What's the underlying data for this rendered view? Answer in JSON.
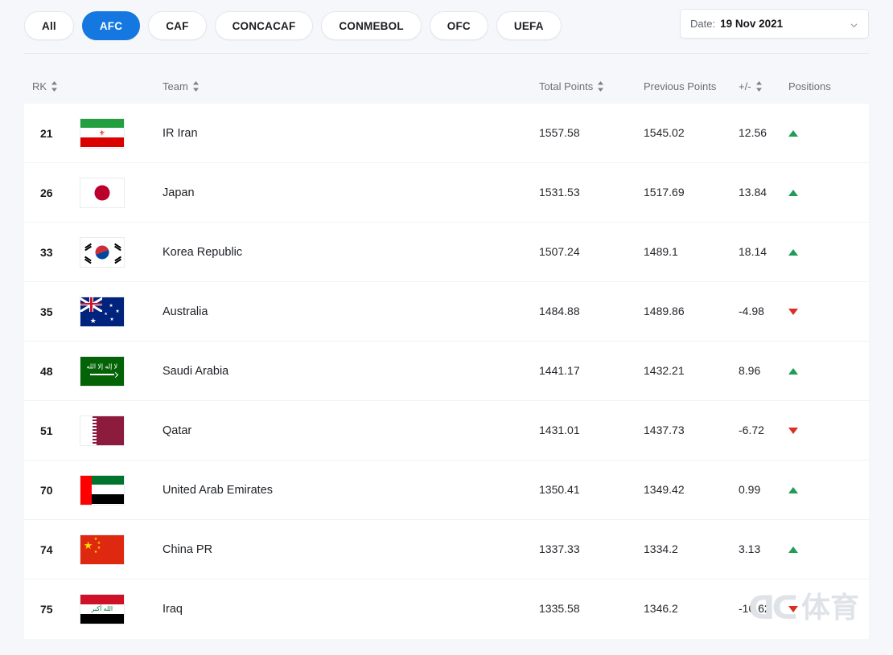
{
  "filters": {
    "items": [
      {
        "label": "All",
        "active": false
      },
      {
        "label": "AFC",
        "active": true
      },
      {
        "label": "CAF",
        "active": false
      },
      {
        "label": "CONCACAF",
        "active": false
      },
      {
        "label": "CONMEBOL",
        "active": false
      },
      {
        "label": "OFC",
        "active": false
      },
      {
        "label": "UEFA",
        "active": false
      }
    ]
  },
  "date_selector": {
    "label": "Date:",
    "value": "19 Nov 2021",
    "chevron_icon": "chevron-down-icon"
  },
  "table": {
    "headers": {
      "rank": "RK",
      "team": "Team",
      "total_points": "Total Points",
      "previous_points": "Previous Points",
      "change": "+/-",
      "positions": "Positions"
    },
    "sortable": {
      "rank": true,
      "team": true,
      "total_points": true,
      "previous_points": false,
      "change": true,
      "positions": false
    },
    "rows": [
      {
        "rank": "21",
        "team": "IR Iran",
        "flag": "iran",
        "total_points": "1557.58",
        "previous_points": "1545.02",
        "change": "12.56",
        "direction": "up"
      },
      {
        "rank": "26",
        "team": "Japan",
        "flag": "japan",
        "total_points": "1531.53",
        "previous_points": "1517.69",
        "change": "13.84",
        "direction": "up"
      },
      {
        "rank": "33",
        "team": "Korea Republic",
        "flag": "korea",
        "total_points": "1507.24",
        "previous_points": "1489.1",
        "change": "18.14",
        "direction": "up"
      },
      {
        "rank": "35",
        "team": "Australia",
        "flag": "aus",
        "total_points": "1484.88",
        "previous_points": "1489.86",
        "change": "-4.98",
        "direction": "down"
      },
      {
        "rank": "48",
        "team": "Saudi Arabia",
        "flag": "ksa",
        "total_points": "1441.17",
        "previous_points": "1432.21",
        "change": "8.96",
        "direction": "up"
      },
      {
        "rank": "51",
        "team": "Qatar",
        "flag": "qat",
        "total_points": "1431.01",
        "previous_points": "1437.73",
        "change": "-6.72",
        "direction": "down"
      },
      {
        "rank": "70",
        "team": "United Arab Emirates",
        "flag": "uae",
        "total_points": "1350.41",
        "previous_points": "1349.42",
        "change": "0.99",
        "direction": "up"
      },
      {
        "rank": "74",
        "team": "China PR",
        "flag": "chn",
        "total_points": "1337.33",
        "previous_points": "1334.2",
        "change": "3.13",
        "direction": "up"
      },
      {
        "rank": "75",
        "team": "Iraq",
        "flag": "irq",
        "total_points": "1335.58",
        "previous_points": "1346.2",
        "change": "-10.62",
        "direction": "down"
      }
    ]
  },
  "watermark": {
    "mark": "ᗡᑕ",
    "text": "体育"
  },
  "colors": {
    "accent": "#1478e0",
    "up": "#1f9d55",
    "down": "#d93025",
    "page_bg": "#f5f7fa",
    "card_bg": "#ffffff"
  }
}
